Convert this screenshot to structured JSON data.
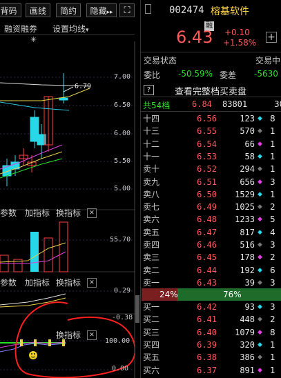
{
  "toolbar": {
    "btn1": "背码",
    "btn2": "画线",
    "btn3": "简约",
    "btn4": "隐藏",
    "btn4_arrow": "▸▸",
    "expand_icon": "⛶",
    "row2_1": "融资融券",
    "row2_2": "设置均线",
    "row2_2_arrow": "▾",
    "star": "✳"
  },
  "chart": {
    "price_axis": [
      "7.00",
      "6.50",
      "6.00",
      "5.50",
      "5.00"
    ],
    "marker": "6.79",
    "vol_axis": "55.70",
    "macd_axis": [
      "0.29",
      "-0.38"
    ],
    "kdj_axis": [
      "100.00",
      "0.00"
    ],
    "vol_params": "参数",
    "vol_add": "加指标",
    "vol_switch": "换指标",
    "vol_close": "✕",
    "macd_params": "参数",
    "macd_add": "加指标",
    "macd_switch": "换指标",
    "macd_close": "✕",
    "kdj_switch": "换指标",
    "kdj_close": "✕"
  },
  "chart_data": {
    "type": "candlestick",
    "ylim": [
      4.85,
      7.25
    ],
    "candles": [
      {
        "open": 5.45,
        "close": 5.3,
        "high": 5.55,
        "low": 5.15
      },
      {
        "open": 5.5,
        "close": 5.4,
        "high": 5.6,
        "low": 5.3
      },
      {
        "open": 5.55,
        "close": 5.6,
        "high": 5.7,
        "low": 5.45
      },
      {
        "open": 5.45,
        "close": 5.5,
        "high": 5.6,
        "low": 5.35
      },
      {
        "open": 6.15,
        "close": 5.8,
        "high": 6.25,
        "low": 5.7
      },
      {
        "open": 5.9,
        "close": 5.75,
        "high": 6.05,
        "low": 5.55
      },
      {
        "open": 5.75,
        "close": 6.45,
        "high": 6.45,
        "low": 5.65
      },
      {
        "open": 6.43,
        "close": 6.4,
        "high": 6.79,
        "low": 6.35
      }
    ]
  },
  "quote": {
    "code": "002474",
    "name": "榕基软件",
    "badge": "融",
    "price": "6.43",
    "change": "+0.10",
    "change_pct": "+1.58%"
  },
  "info": {
    "status_label": "交易状态",
    "status_label2": "交易中",
    "weibi_label": "委比",
    "weibi_value": "-50.59%",
    "weicha_label": "委差",
    "weicha_value": "-5630",
    "help_mark": "?",
    "full_book": "查看完整档买卖盘",
    "total_levels": "共54档",
    "total_price": "6.84",
    "total_vol": "83801",
    "total_extra": "30"
  },
  "sells": [
    {
      "name": "十四",
      "price": "6.56",
      "vol": "123",
      "mark": "◆",
      "extra": "8"
    },
    {
      "name": "十三",
      "price": "6.55",
      "vol": "570",
      "mark": "◆",
      "extra": "1"
    },
    {
      "name": "十二",
      "price": "6.54",
      "vol": "66",
      "mark": "◆",
      "extra": "1"
    },
    {
      "name": "十一",
      "price": "6.53",
      "vol": "58",
      "mark": "◆",
      "extra": "1"
    },
    {
      "name": "卖十",
      "price": "6.52",
      "vol": "294",
      "mark": "◆",
      "extra": "1"
    },
    {
      "name": "卖九",
      "price": "6.51",
      "vol": "656",
      "mark": "◆",
      "extra": "3"
    },
    {
      "name": "卖八",
      "price": "6.50",
      "vol": "1529",
      "mark": "◆",
      "extra": "1"
    },
    {
      "name": "卖七",
      "price": "6.49",
      "vol": "1025",
      "mark": "◆",
      "extra": "2"
    },
    {
      "name": "卖六",
      "price": "6.48",
      "vol": "1233",
      "mark": "◆",
      "extra": "5"
    },
    {
      "name": "卖五",
      "price": "6.47",
      "vol": "817",
      "mark": "◆",
      "extra": "4"
    },
    {
      "name": "卖四",
      "price": "6.46",
      "vol": "516",
      "mark": "◆",
      "extra": "3"
    },
    {
      "name": "卖三",
      "price": "6.45",
      "vol": "178",
      "mark": "◆",
      "extra": "2"
    },
    {
      "name": "卖二",
      "price": "6.44",
      "vol": "192",
      "mark": "◆",
      "extra": "6"
    },
    {
      "name": "卖一",
      "price": "6.43",
      "vol": "39",
      "mark": "◆",
      "extra": "3"
    }
  ],
  "ratio": {
    "sell_pct": "24%",
    "buy_pct": "76%"
  },
  "buys": [
    {
      "name": "买一",
      "price": "6.42",
      "vol": "93",
      "mark": "◆",
      "extra": "3"
    },
    {
      "name": "买二",
      "price": "6.41",
      "vol": "448",
      "mark": "◆",
      "extra": "2"
    },
    {
      "name": "买三",
      "price": "6.40",
      "vol": "1079",
      "mark": "◆",
      "extra": "8"
    },
    {
      "name": "买四",
      "price": "6.39",
      "vol": "320",
      "mark": "◆",
      "extra": "1"
    },
    {
      "name": "买五",
      "price": "6.38",
      "vol": "386",
      "mark": "◆",
      "extra": "1"
    },
    {
      "name": "买六",
      "price": "6.37",
      "vol": "891",
      "mark": "◆",
      "extra": "1"
    }
  ]
}
